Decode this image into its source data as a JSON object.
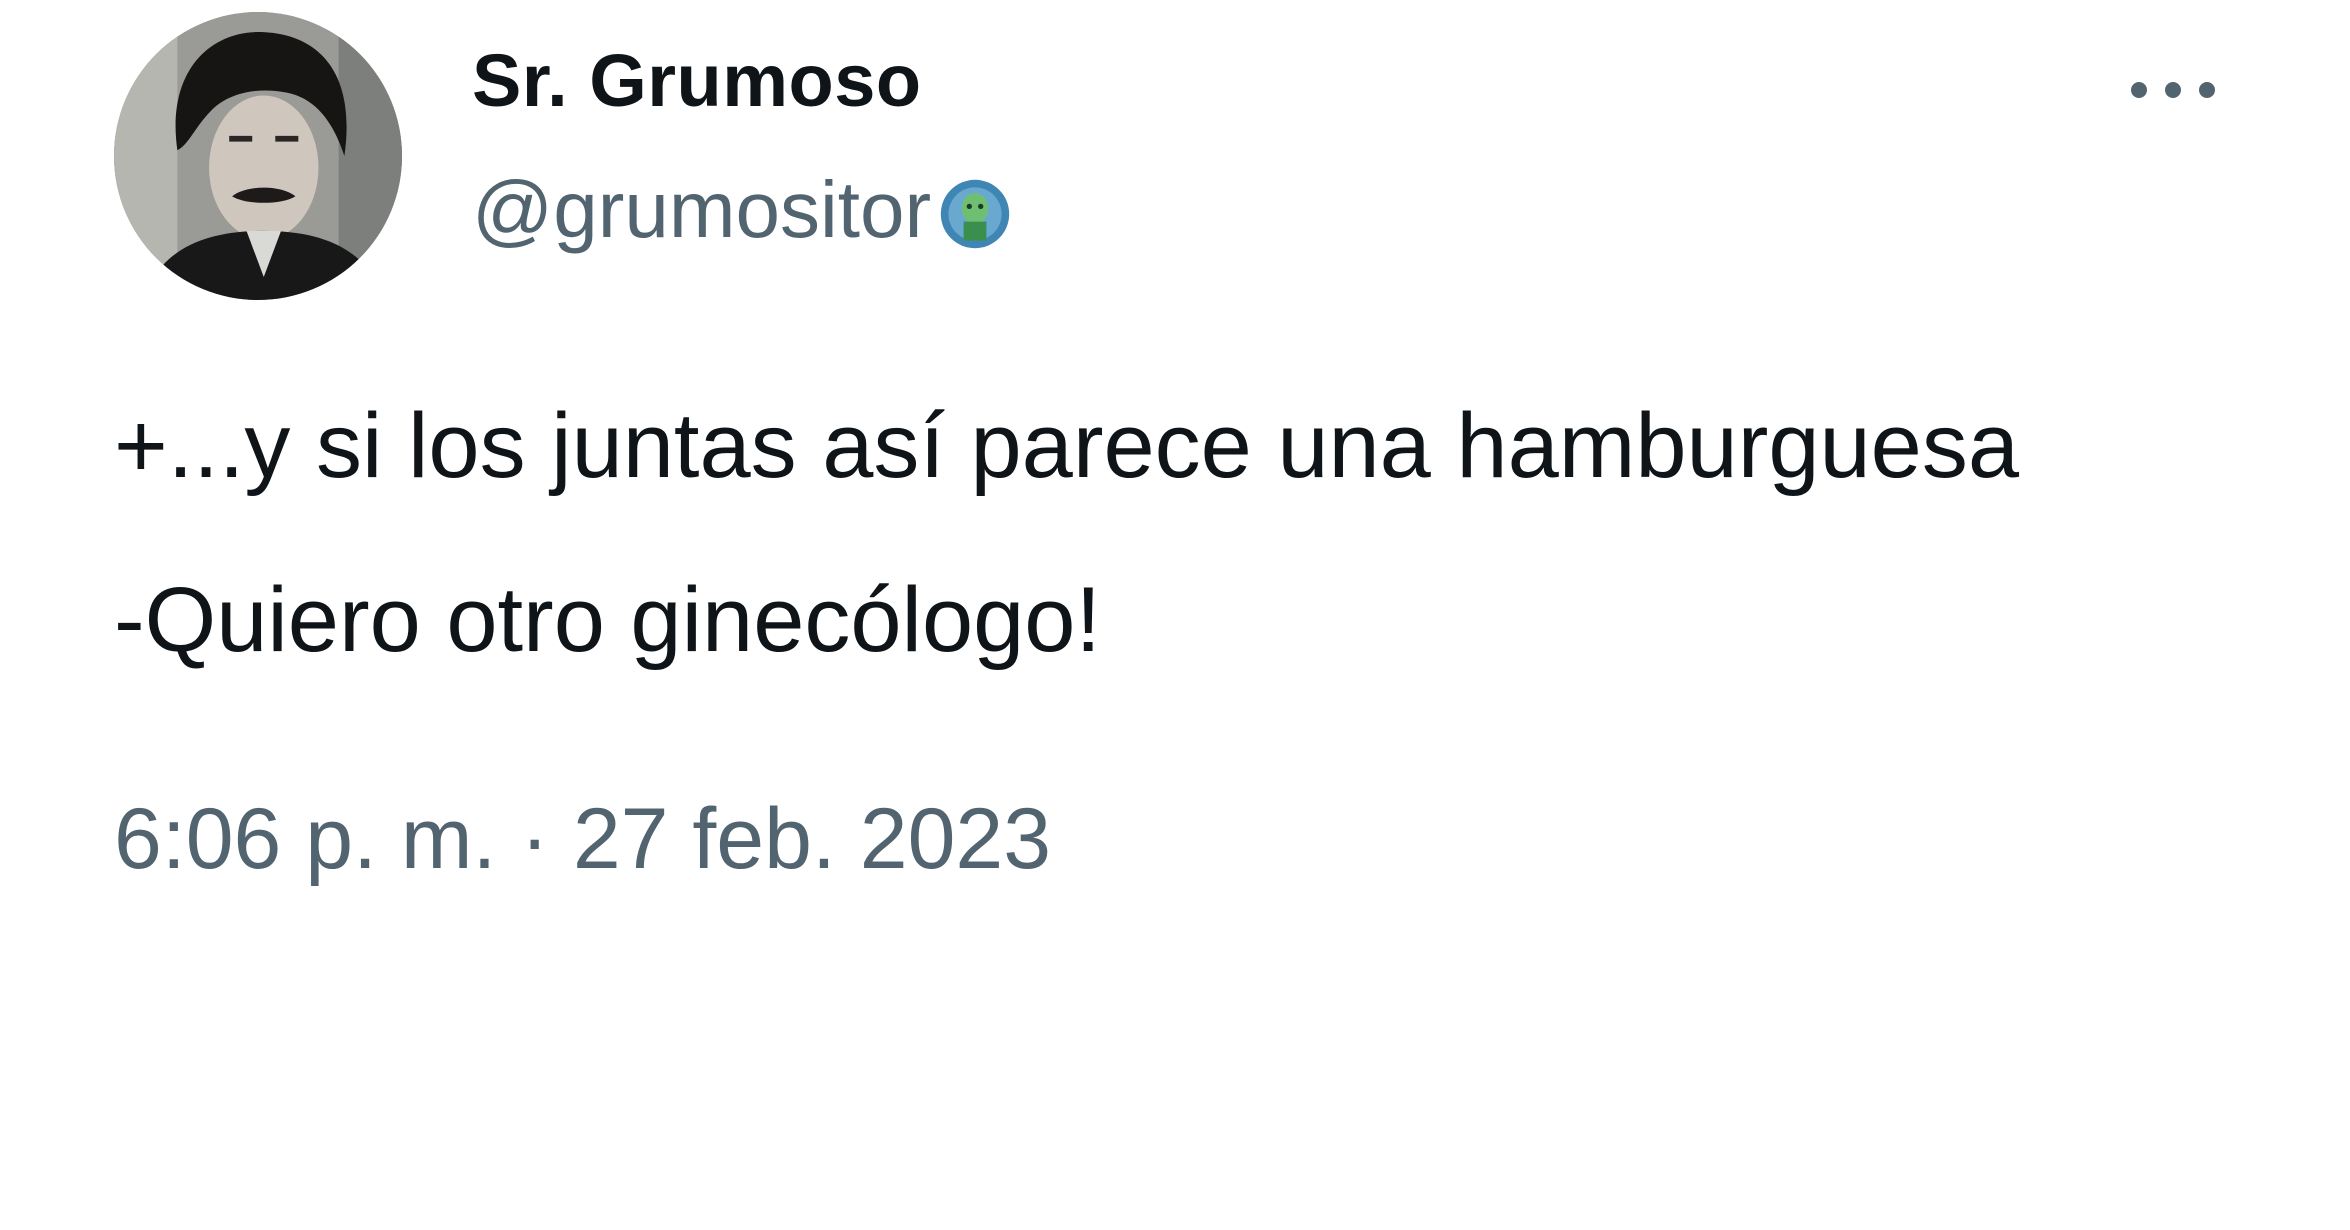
{
  "tweet": {
    "author": {
      "display_name": "Sr. Grumoso",
      "handle": "@grumositor",
      "avatar_icon": "profile-photo",
      "badge_icon": "handle-emoji-badge"
    },
    "more_icon": "more-options-icon",
    "text_lines": [
      "+...y si los juntas así parece una hamburguesa",
      "-Quiero otro ginecólogo!"
    ],
    "timestamp": "6:06 p. m. · 27 feb. 2023"
  },
  "colors": {
    "primary_text": "#0f1419",
    "secondary_text": "#536471",
    "background": "#ffffff"
  }
}
